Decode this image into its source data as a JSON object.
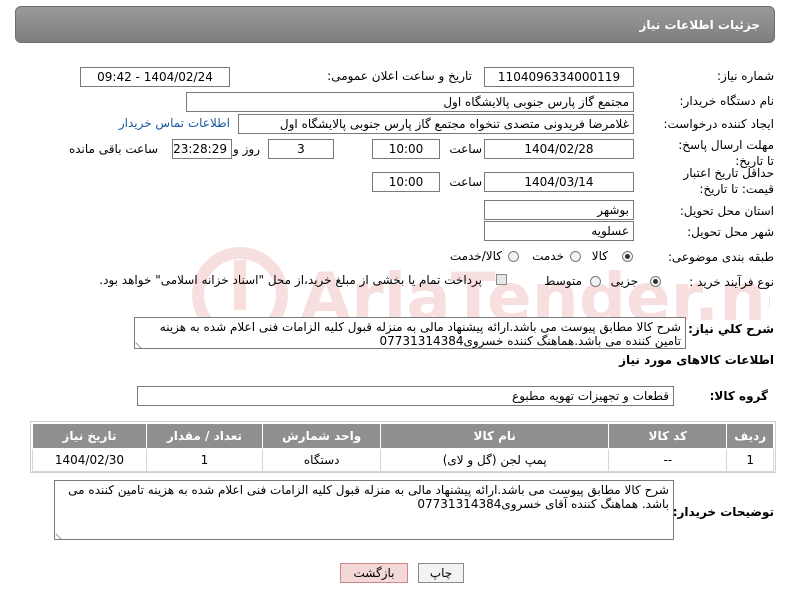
{
  "header": {
    "title": "جزئیات اطلاعات نیاز"
  },
  "form": {
    "need_number_label": "شماره نیاز:",
    "need_number": "1104096334000119",
    "announce_label": "تاریخ و ساعت اعلان عمومی:",
    "announce_value": "1404/02/24 - 09:42",
    "buyer_org_label": "نام دستگاه خریدار:",
    "buyer_org": "مجتمع گاز پارس جنوبی  پالایشگاه اول",
    "requester_label": "ایجاد کننده درخواست:",
    "requester": "غلامرضا فریدونی متصدی تنخواه مجتمع گاز پارس جنوبی  پالایشگاه اول",
    "buyer_contact_link": "اطلاعات تماس خریدار",
    "reply_deadline_label": "مهلت ارسال پاسخ: تا تاریخ:",
    "reply_date": "1404/02/28",
    "time_label": "ساعت",
    "reply_time": "10:00",
    "days_value": "3",
    "days_label": "روز و",
    "remaining_time": "23:28:29",
    "remaining_label": "ساعت باقی مانده",
    "price_validity_label": "حداقل تاریخ اعتبار قیمت: تا تاریخ:",
    "price_date": "1404/03/14",
    "price_time": "10:00",
    "province_label": "استان محل تحویل:",
    "province": "بوشهر",
    "city_label": "شهر محل تحویل:",
    "city": "عسلویه",
    "category_label": "طبقه بندی موضوعی:",
    "category_options": [
      "کالا",
      "خدمت",
      "کالا/خدمت"
    ],
    "purchase_type_label": "نوع فرآیند خرید :",
    "purchase_options": [
      "جزیی",
      "متوسط"
    ],
    "payment_note": "پرداخت تمام یا بخشی از مبلغ خرید،از محل \"اسناد خزانه اسلامی\" خواهد بود.",
    "summary_label": "شرح کلي نياز:",
    "summary_text": "شرح کالا مطابق پیوست می باشد.ارائه پیشنهاد مالی به منزله قبول کلیه الزامات فنی اعلام شده به هزینه تامین کننده می باشد.هماهنگ کننده خسروی07731314384",
    "goods_info_title": "اطلاعات کالاهای مورد نیاز",
    "goods_group_label": "گروه کالا:",
    "goods_group": "قطعات و تجهیزات تهویه مطبوع"
  },
  "table": {
    "headers": [
      "ردیف",
      "کد کالا",
      "نام کالا",
      "واحد شمارش",
      "تعداد / مقدار",
      "تاریخ نیاز"
    ],
    "rows": [
      [
        "1",
        "--",
        "پمپ لجن (گل و لای)",
        "دستگاه",
        "1",
        "1404/02/30"
      ]
    ]
  },
  "buyer_notes": {
    "label": "توضیحات خریدار:",
    "text": "شرح کالا مطابق پیوست می باشد.ارائه پیشنهاد مالی  به منزله قبول کلیه الزامات فنی اعلام شده به هزینه تامین کننده می باشد. هماهنگ کننده آقای خسروی07731314384"
  },
  "buttons": {
    "print": "چاپ",
    "back": "بازگشت"
  },
  "watermark": {
    "text": "AriaTender.net"
  }
}
